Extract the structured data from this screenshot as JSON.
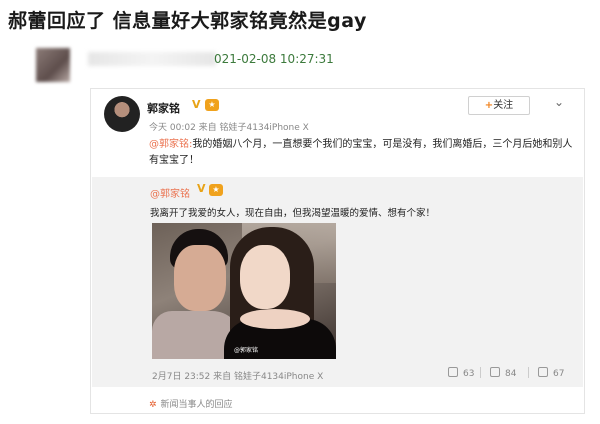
{
  "page": {
    "title": "郝蕾回应了 信息量好大郭家铭竟然是gay"
  },
  "post": {
    "time": "021-02-08 10:27:31"
  },
  "weibo": {
    "author": "郭家铭",
    "verified_badge": "V",
    "meta": "今天 00:02 来自 铭娃子4134iPhone X",
    "follow_label": "关注",
    "follow_plus": "+",
    "menu_icon": "chevron-down-icon",
    "mention": "@郭家铭:",
    "text": "我的婚姻八个月，一直想要个我们的宝宝，可是没有，我们离婚后，三个月后她和别人有宝宝了！"
  },
  "original": {
    "author": "@郭家铭",
    "verified_badge": "V",
    "text": "我离开了我爱的女人，现在自由，但我渴望温暖的爱情、想有个家！",
    "photo_watermark": "@郭家铭",
    "meta": "2月7日 23:52 来自 铭娃子4134iPhone X",
    "repost_count": "63",
    "comment_count": "84",
    "like_count": "67"
  },
  "footer": {
    "reply_link": "新闻当事人的回应"
  },
  "colors": {
    "accent": "#eb7350",
    "badge": "#f0a21d",
    "timestamp": "#3c7a3c"
  }
}
